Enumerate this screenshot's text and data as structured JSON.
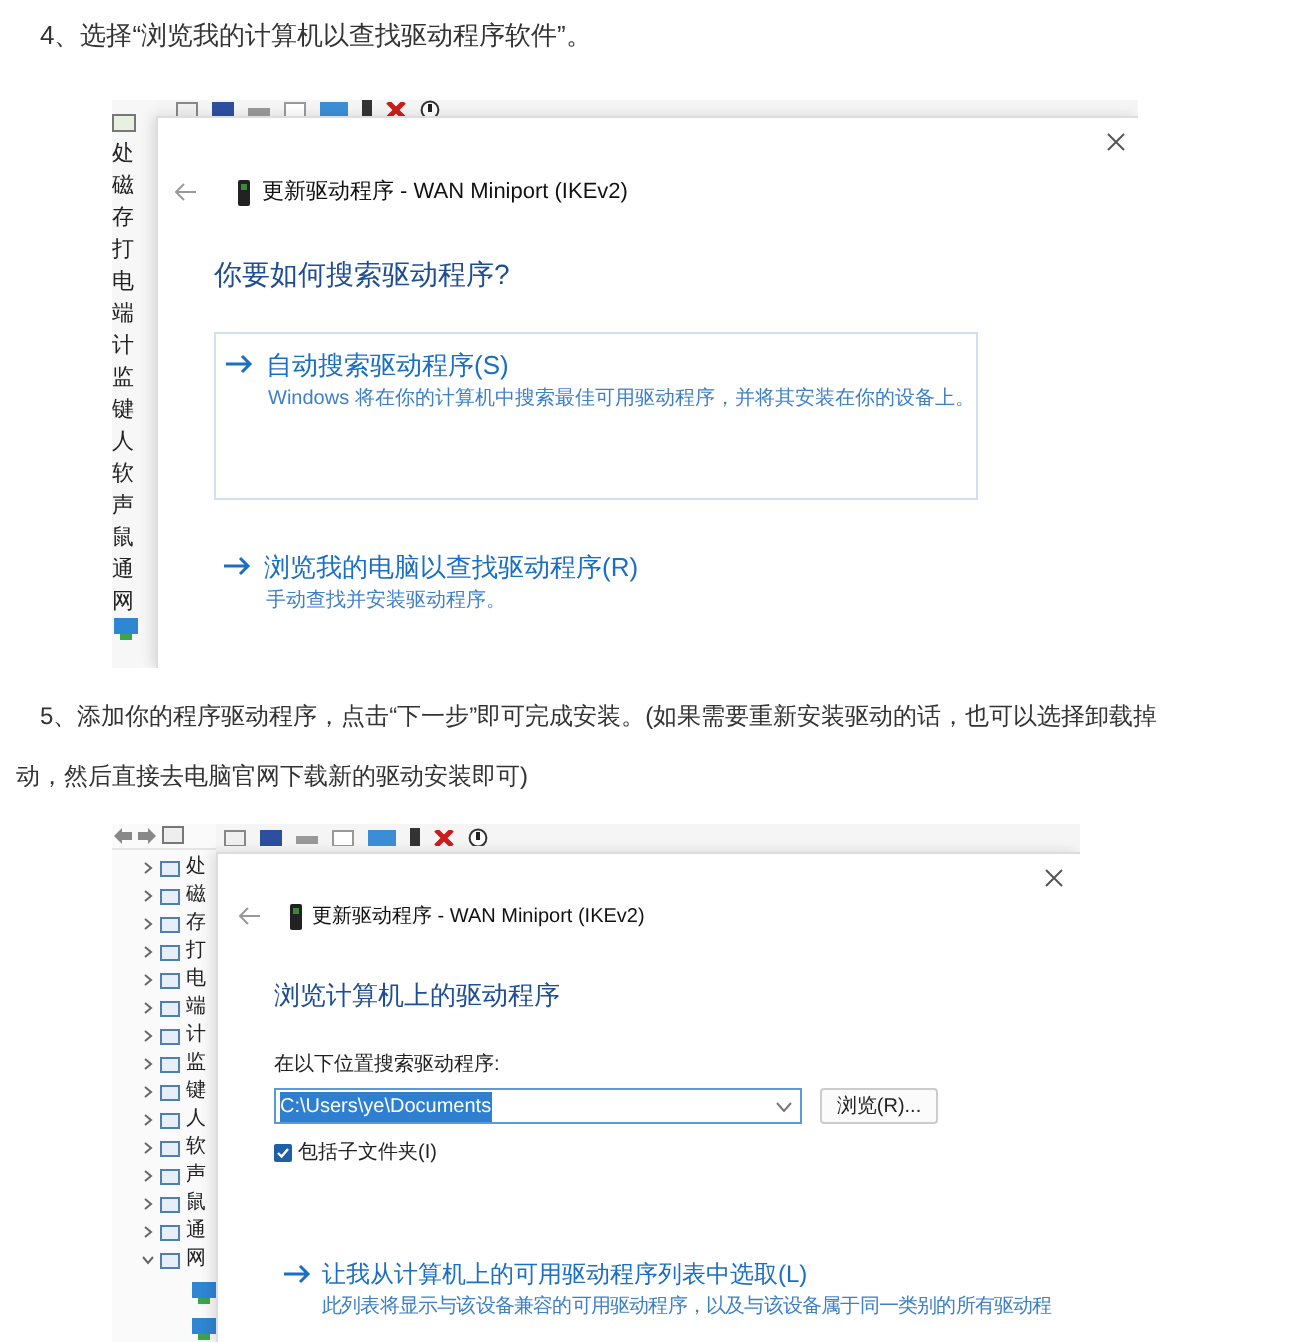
{
  "step4": {
    "text": "4、选择“浏览我的计算机以查找驱动程序软件”。"
  },
  "screenshot1": {
    "device_list": [
      "处",
      "磁",
      "存",
      "打",
      "电",
      "端",
      "计",
      "监",
      "键",
      "人",
      "软",
      "声",
      "鼠",
      "通",
      "网"
    ],
    "dialog": {
      "title": "更新驱动程序 - WAN Miniport (IKEv2)",
      "heading": "你要如何搜索驱动程序?",
      "options": [
        {
          "label": "自动搜索驱动程序(S)",
          "description": "Windows 将在你的计算机中搜索最佳可用驱动程序，并将其安装在你的设备上。",
          "boxed": true
        },
        {
          "label": "浏览我的电脑以查找驱动程序(R)",
          "description": "手动查找并安装驱动程序。",
          "boxed": false
        }
      ]
    }
  },
  "step5": {
    "line1": "5、添加你的程序驱动程序，点击“下一步”即可完成安装。(如果需要重新安装驱动的话，也可以选择卸载掉",
    "line2": "动，然后直接去电脑官网下载新的驱动安装即可)"
  },
  "screenshot2": {
    "device_tree": [
      {
        "label": "处",
        "expanded": false
      },
      {
        "label": "磁",
        "expanded": false
      },
      {
        "label": "存",
        "expanded": false
      },
      {
        "label": "打",
        "expanded": false
      },
      {
        "label": "电",
        "expanded": false
      },
      {
        "label": "端",
        "expanded": false
      },
      {
        "label": "计",
        "expanded": false
      },
      {
        "label": "监",
        "expanded": false
      },
      {
        "label": "键",
        "expanded": false
      },
      {
        "label": "人",
        "expanded": false
      },
      {
        "label": "软",
        "expanded": false
      },
      {
        "label": "声",
        "expanded": false
      },
      {
        "label": "鼠",
        "expanded": false
      },
      {
        "label": "通",
        "expanded": false
      },
      {
        "label": "网",
        "expanded": true
      }
    ],
    "dialog": {
      "title": "更新驱动程序 - WAN Miniport (IKEv2)",
      "heading": "浏览计算机上的驱动程序",
      "field_label": "在以下位置搜索驱动程序:",
      "path_field": {
        "value": "C:\\Users\\ye\\Documents",
        "selected": true
      },
      "browse_button": "浏览(R)...",
      "include_subfolders": {
        "label": "包括子文件夹(I)",
        "checked": true
      },
      "option": {
        "label": "让我从计算机上的可用驱动程序列表中选取(L)",
        "description": "此列表将显示与该设备兼容的可用驱动程序，以及与该设备属于同一类别的所有驱动程"
      }
    }
  }
}
